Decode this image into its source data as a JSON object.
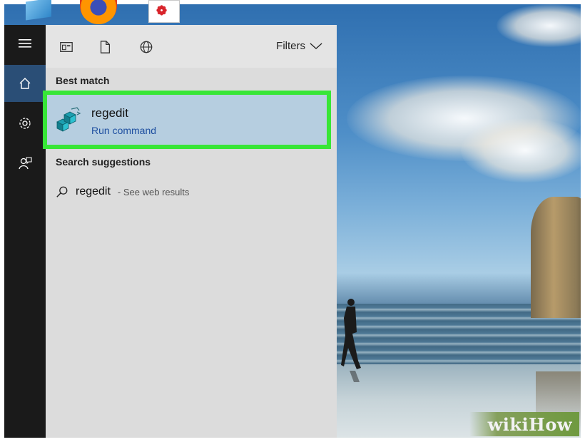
{
  "colors": {
    "sidebar_bg": "#1a1a1a",
    "sidebar_active": "#2a4e76",
    "panel_bg": "#dcdcdc",
    "best_match_bg": "#b6cee0",
    "highlight_border": "#37e637",
    "link_blue": "#1e4fa0"
  },
  "sidebar": {
    "items": [
      {
        "icon": "hamburger-menu-icon"
      },
      {
        "icon": "home-icon",
        "active": true
      },
      {
        "icon": "gear-icon"
      },
      {
        "icon": "feedback-icon"
      }
    ]
  },
  "toolbar": {
    "tabs": [
      {
        "icon": "apps-icon"
      },
      {
        "icon": "documents-icon"
      },
      {
        "icon": "web-globe-icon"
      }
    ],
    "filters_label": "Filters"
  },
  "best_match": {
    "heading": "Best match",
    "title": "regedit",
    "subtitle": "Run command",
    "icon": "registry-editor-icon"
  },
  "suggestions": {
    "heading": "Search suggestions",
    "items": [
      {
        "query": "regedit",
        "hint": "- See web results",
        "icon": "search-icon"
      }
    ]
  },
  "watermark": {
    "text": "wikiHow"
  }
}
